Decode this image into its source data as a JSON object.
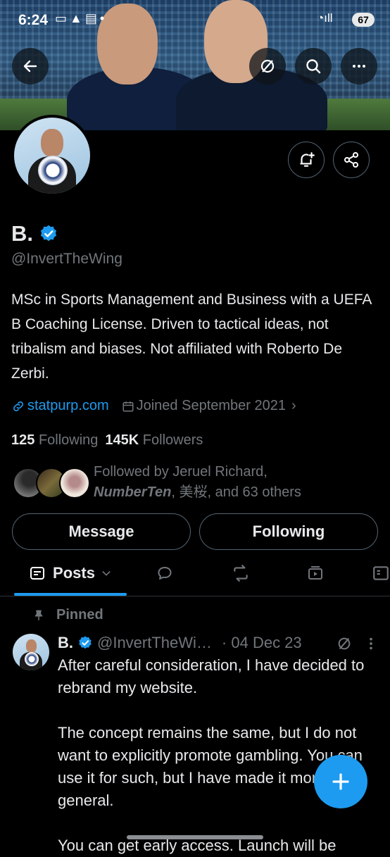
{
  "status_bar": {
    "time": "6:24",
    "battery": "67"
  },
  "header": {
    "back_icon": "arrow-left-icon",
    "grok_icon": "grok-icon",
    "search_icon": "search-icon",
    "more_icon": "more-icon"
  },
  "profile": {
    "name": "B.",
    "handle": "@InvertTheWing",
    "bio": "MSc in Sports Management and Business with a UEFA B Coaching License. Driven to tactical ideas, not tribalism and biases. Not affiliated with Roberto De Zerbi.",
    "website": "statpurp.com",
    "joined": "Joined September 2021",
    "following_count": "125",
    "following_label": "Following",
    "followers_count": "145K",
    "followers_label": "Followers",
    "followed_by_prefix": "Followed by Jeruel Richard,",
    "followed_by_bold": "NumberTen",
    "followed_by_rest": ", 美桜, and 63 others"
  },
  "actions": {
    "message": "Message",
    "following": "Following"
  },
  "tabs": {
    "posts": "Posts"
  },
  "pinned_label": "Pinned",
  "tweet": {
    "name": "B.",
    "handle": "@InvertTheWi…",
    "date": "· 04 Dec 23",
    "text": "After careful consideration, I have decided to rebrand my website.\n\nThe concept remains the same, but I do not want to explicitly promote gambling. You can use it for such, but I have made it more general.\n\nYou can get early access. Launch will be"
  },
  "colors": {
    "accent": "#1d9bf0",
    "muted": "#71767b",
    "border": "#536471"
  }
}
